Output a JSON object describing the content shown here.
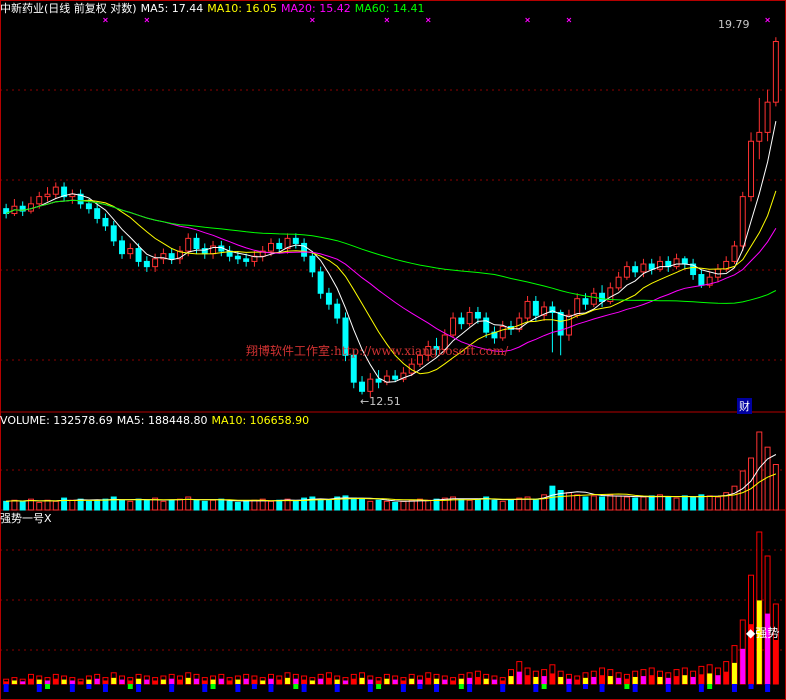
{
  "header": {
    "title": "中新药业(日线 前复权 对数)",
    "ma5": "MA5: 17.44",
    "ma10": "MA10: 16.05",
    "ma20": "MA20: 15.42",
    "ma60": "MA60: 14.41"
  },
  "volume_header": {
    "label": "VOLUME: 132578.69",
    "ma5": "MA5: 188448.80",
    "ma10": "MA10: 106658.90"
  },
  "indicator_header": {
    "label": "强势一号X"
  },
  "annotations": {
    "high_label": "19.79",
    "low_label": "←12.51",
    "cai_marker": "财",
    "strong_signal": "◆强势",
    "watermark": "翔博软件工作室:http://www.xiangbosoft.com/"
  },
  "colors": {
    "background": "#000000",
    "up": "#ff3232",
    "down": "#00ffff",
    "ma5": "#ffffff",
    "ma10": "#ffff00",
    "ma20": "#ff00ff",
    "ma60": "#00ff00",
    "grid": "#8b0000",
    "title": "#ffffff",
    "indicator_red": "#ff0000",
    "indicator_yellow": "#ffff00",
    "indicator_green": "#00ff00",
    "indicator_blue": "#0000ff",
    "indicator_magenta": "#ff00ff",
    "marker_x": "#ff00ff"
  },
  "chart_data": [
    {
      "type": "candlestick",
      "title": "中新药业(日线 前复权 对数)",
      "scale": "log",
      "ylim": [
        12.3,
        20.4
      ],
      "grid": true,
      "candles": [
        [
          15.95,
          15.85,
          16.05,
          15.75
        ],
        [
          15.85,
          16.0,
          16.15,
          15.8
        ],
        [
          16.0,
          15.9,
          16.1,
          15.8
        ],
        [
          15.9,
          16.05,
          16.2,
          15.85
        ],
        [
          16.05,
          16.2,
          16.3,
          15.95
        ],
        [
          16.2,
          16.25,
          16.4,
          16.1
        ],
        [
          16.25,
          16.4,
          16.5,
          16.15
        ],
        [
          16.4,
          16.2,
          16.5,
          16.1
        ],
        [
          16.2,
          16.25,
          16.35,
          16.05
        ],
        [
          16.25,
          16.05,
          16.35,
          15.95
        ],
        [
          16.05,
          15.95,
          16.15,
          15.85
        ],
        [
          15.95,
          15.75,
          16.05,
          15.65
        ],
        [
          15.75,
          15.6,
          15.85,
          15.5
        ],
        [
          15.6,
          15.3,
          15.7,
          15.2
        ],
        [
          15.3,
          15.05,
          15.4,
          14.95
        ],
        [
          15.05,
          15.15,
          15.25,
          14.95
        ],
        [
          15.15,
          14.9,
          15.25,
          14.8
        ],
        [
          14.9,
          14.8,
          15.0,
          14.7
        ],
        [
          14.8,
          14.95,
          15.05,
          14.7
        ],
        [
          14.95,
          15.05,
          15.15,
          14.85
        ],
        [
          15.05,
          14.95,
          15.15,
          14.85
        ],
        [
          14.95,
          15.1,
          15.2,
          14.85
        ],
        [
          15.1,
          15.35,
          15.45,
          15.0
        ],
        [
          15.35,
          15.15,
          15.45,
          15.05
        ],
        [
          15.15,
          15.05,
          15.25,
          14.95
        ],
        [
          15.05,
          15.2,
          15.3,
          14.95
        ],
        [
          15.2,
          15.1,
          15.3,
          15.0
        ],
        [
          15.1,
          15.0,
          15.2,
          14.9
        ],
        [
          15.0,
          14.95,
          15.1,
          14.85
        ],
        [
          14.95,
          14.9,
          15.05,
          14.8
        ],
        [
          14.9,
          15.0,
          15.1,
          14.8
        ],
        [
          15.0,
          15.1,
          15.2,
          14.9
        ],
        [
          15.1,
          15.25,
          15.35,
          15.0
        ],
        [
          15.25,
          15.15,
          15.35,
          15.05
        ],
        [
          15.15,
          15.35,
          15.45,
          15.05
        ],
        [
          15.35,
          15.25,
          15.45,
          15.15
        ],
        [
          15.25,
          15.0,
          15.35,
          14.9
        ],
        [
          15.0,
          14.7,
          15.1,
          14.6
        ],
        [
          14.7,
          14.3,
          14.8,
          14.2
        ],
        [
          14.3,
          14.1,
          14.4,
          14.0
        ],
        [
          14.1,
          13.85,
          14.2,
          13.75
        ],
        [
          13.85,
          13.2,
          13.95,
          13.1
        ],
        [
          13.2,
          12.75,
          13.3,
          12.65
        ],
        [
          12.75,
          12.6,
          12.85,
          12.55
        ],
        [
          12.6,
          12.8,
          12.9,
          12.5
        ],
        [
          12.8,
          12.75,
          12.95,
          12.65
        ],
        [
          12.75,
          12.85,
          12.95,
          12.7
        ],
        [
          12.85,
          12.8,
          12.95,
          12.75
        ],
        [
          12.8,
          12.9,
          13.0,
          12.75
        ],
        [
          12.9,
          13.05,
          13.15,
          12.85
        ],
        [
          13.05,
          13.2,
          13.3,
          13.0
        ],
        [
          13.2,
          13.35,
          13.45,
          13.1
        ],
        [
          13.35,
          13.3,
          13.5,
          13.2
        ],
        [
          13.3,
          13.55,
          13.65,
          13.25
        ],
        [
          13.55,
          13.85,
          13.95,
          13.5
        ],
        [
          13.85,
          13.75,
          13.95,
          13.65
        ],
        [
          13.75,
          13.95,
          14.05,
          13.7
        ],
        [
          13.95,
          13.85,
          14.05,
          13.75
        ],
        [
          13.85,
          13.6,
          13.95,
          13.5
        ],
        [
          13.6,
          13.5,
          13.7,
          13.4
        ],
        [
          13.5,
          13.7,
          13.8,
          13.45
        ],
        [
          13.7,
          13.65,
          13.8,
          13.55
        ],
        [
          13.65,
          13.85,
          13.95,
          13.6
        ],
        [
          13.85,
          14.15,
          14.25,
          13.8
        ],
        [
          14.15,
          13.9,
          14.25,
          13.8
        ],
        [
          13.9,
          14.05,
          14.15,
          13.8
        ],
        [
          14.05,
          13.95,
          14.15,
          13.25
        ],
        [
          13.95,
          13.55,
          14.0,
          13.2
        ],
        [
          13.55,
          13.9,
          14.0,
          13.45
        ],
        [
          13.9,
          14.2,
          14.3,
          13.85
        ],
        [
          14.2,
          14.1,
          14.3,
          14.0
        ],
        [
          14.1,
          14.3,
          14.4,
          14.05
        ],
        [
          14.3,
          14.15,
          14.45,
          14.05
        ],
        [
          14.15,
          14.4,
          14.5,
          14.1
        ],
        [
          14.4,
          14.6,
          14.7,
          14.35
        ],
        [
          14.6,
          14.8,
          14.9,
          14.55
        ],
        [
          14.8,
          14.7,
          14.9,
          14.6
        ],
        [
          14.7,
          14.85,
          14.95,
          14.6
        ],
        [
          14.85,
          14.75,
          14.95,
          14.65
        ],
        [
          14.75,
          14.9,
          15.0,
          14.7
        ],
        [
          14.9,
          14.8,
          15.0,
          14.7
        ],
        [
          14.8,
          14.95,
          15.05,
          14.75
        ],
        [
          14.95,
          14.85,
          15.0,
          14.75
        ],
        [
          14.85,
          14.65,
          14.95,
          14.55
        ],
        [
          14.65,
          14.45,
          14.75,
          14.4
        ],
        [
          14.45,
          14.6,
          14.7,
          14.4
        ],
        [
          14.6,
          14.75,
          14.85,
          14.5
        ],
        [
          14.75,
          14.9,
          15.0,
          14.7
        ],
        [
          14.9,
          15.2,
          15.3,
          14.85
        ],
        [
          15.2,
          16.2,
          16.3,
          15.1
        ],
        [
          16.2,
          17.4,
          17.6,
          16.1
        ],
        [
          17.4,
          17.6,
          18.4,
          17.0
        ],
        [
          17.6,
          18.3,
          18.6,
          17.4
        ],
        [
          18.3,
          19.79,
          19.9,
          18.2
        ]
      ],
      "x_range": [
        1,
        94
      ],
      "moving_averages": [
        {
          "name": "MA5",
          "value": 17.44
        },
        {
          "name": "MA10",
          "value": 16.05
        },
        {
          "name": "MA20",
          "value": 15.42
        },
        {
          "name": "MA60",
          "value": 14.41
        }
      ],
      "high_marker": 19.79,
      "low_marker": 12.51
    },
    {
      "type": "bar",
      "title": "VOLUME",
      "latest": 132578.69,
      "ma5": 188448.8,
      "ma10": 106658.9,
      "values": [
        8,
        9,
        8,
        10,
        7,
        9,
        8,
        11,
        9,
        10,
        8,
        9,
        10,
        12,
        9,
        8,
        10,
        9,
        11,
        8,
        9,
        10,
        12,
        9,
        8,
        9,
        10,
        8,
        7,
        8,
        9,
        10,
        8,
        9,
        10,
        8,
        11,
        12,
        10,
        9,
        12,
        13,
        11,
        10,
        8,
        9,
        8,
        7,
        8,
        9,
        10,
        9,
        10,
        11,
        12,
        10,
        9,
        10,
        12,
        9,
        8,
        9,
        11,
        12,
        10,
        14,
        22,
        18,
        16,
        14,
        12,
        13,
        12,
        14,
        13,
        12,
        11,
        12,
        13,
        14,
        12,
        11,
        13,
        12,
        14,
        13,
        12,
        16,
        22,
        36,
        48,
        72,
        58,
        42
      ]
    },
    {
      "type": "bar",
      "title": "强势一号X",
      "annotation": "强势",
      "values": [
        3,
        4,
        3,
        6,
        5,
        4,
        6,
        5,
        4,
        3,
        5,
        6,
        4,
        7,
        5,
        4,
        6,
        5,
        4,
        5,
        6,
        5,
        7,
        6,
        4,
        5,
        6,
        4,
        5,
        6,
        5,
        4,
        6,
        5,
        7,
        6,
        5,
        4,
        6,
        7,
        5,
        4,
        6,
        7,
        5,
        4,
        6,
        5,
        4,
        6,
        5,
        7,
        6,
        5,
        4,
        6,
        7,
        8,
        6,
        5,
        4,
        9,
        14,
        10,
        8,
        9,
        12,
        8,
        6,
        5,
        7,
        8,
        10,
        9,
        7,
        6,
        8,
        9,
        10,
        8,
        7,
        9,
        10,
        8,
        11,
        12,
        10,
        14,
        24,
        40,
        68,
        95,
        80,
        50
      ]
    }
  ]
}
